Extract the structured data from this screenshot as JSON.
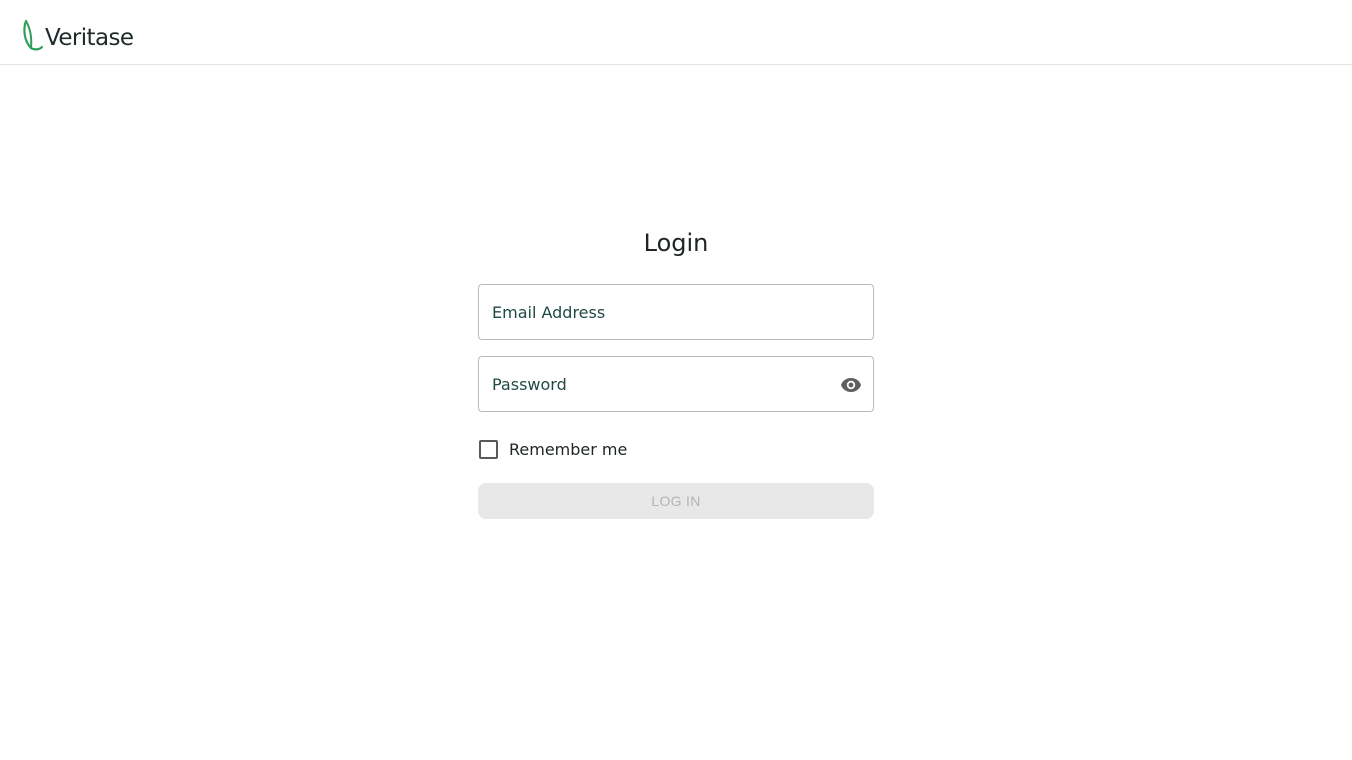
{
  "header": {
    "logo_text": "Veritase"
  },
  "login": {
    "title": "Login",
    "email_placeholder": "Email Address",
    "email_value": "",
    "password_placeholder": "Password",
    "password_value": "",
    "show_password_icon": "eye-icon",
    "remember_label": "Remember me",
    "remember_checked": false,
    "submit_label": "LOG IN",
    "submit_disabled": true
  },
  "colors": {
    "brand_green": "#2e9e5a",
    "text_dark": "#1f2426",
    "button_disabled_bg": "#e8e8e8",
    "button_disabled_text": "#b4b4b4",
    "field_border": "#b9b9b9"
  }
}
